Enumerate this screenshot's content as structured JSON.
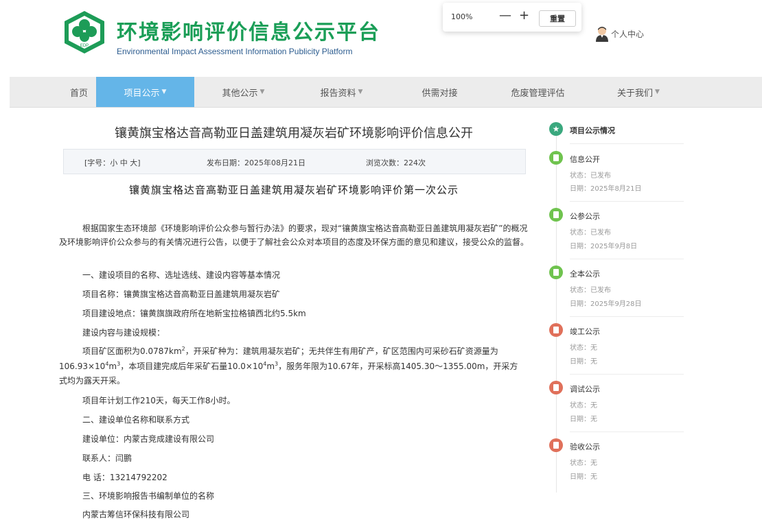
{
  "header": {
    "title": "环境影响评价信息公示平台",
    "subtitle": "Environmental Impact Assessment Information Publicity Platform",
    "logo_text": "EDP"
  },
  "zoom": {
    "level": "100%",
    "minus": "—",
    "plus": "+",
    "reset": "重置"
  },
  "user": {
    "label": "个人中心"
  },
  "nav": {
    "home": "首页",
    "project": "项目公示",
    "other": "其他公示",
    "report": "报告资料",
    "supply": "供需对接",
    "hazard": "危废管理评估",
    "about": "关于我们"
  },
  "article": {
    "title": "镶黄旗宝格达音高勒亚日盖建筑用凝灰岩矿环境影响评价信息公开",
    "font_size": "[字号：小 中 大]",
    "date": "发布日期：2025年08月21日",
    "views": "浏览次数：224次",
    "subtitle": "镶黄旗宝格达音高勒亚日盖建筑用凝灰岩矿环境影响评价第一次公示",
    "intro": "根据国家生态环境部《环境影响评价公众参与暂行办法》的要求，现对“镶黄旗宝格达音高勒亚日盖建筑用凝灰岩矿”的概况及环境影响评价公众参与的有关情况进行公告，以便于了解社会公众对本项目的态度及环保方面的意见和建议，接受公众的监督。",
    "sec1": "一、建设项目的名称、选址选线、建设内容等基本情况",
    "name_line": "项目名称：镶黄旗宝格达音高勒亚日盖建筑用凝灰岩矿",
    "location": "项目建设地点：镶黄旗旗政府所在地新宝拉格镇西北约5.5km",
    "scale_label": "建设内容与建设规模：",
    "scale_a": "项目矿区面积为0.0787km",
    "scale_b": "，开采矿种为：建筑用凝灰岩矿；无共伴生有用矿产，矿区范围内可采砂石矿资源量为",
    "scale_c": "106.93×10",
    "scale_d": "m",
    "scale_e": "，本项目建完成后年采矿石量10.0×10",
    "scale_f": "m",
    "scale_g": "，服务年限为10.67年，开采标高1405.30～1355.00m，开采方",
    "scale_h": "式均为露天开采。",
    "sup2": "2",
    "sup4": "4",
    "sup3": "3",
    "work": "项目年计划工作210天，每天工作8小时。",
    "sec2": "二、建设单位名称和联系方式",
    "unit": "建设单位：内蒙古竞成建设有限公司",
    "contact": "联系人：闫鹏",
    "phone": "电  话：13214792202",
    "sec3": "三、环境影响报告书编制单位的名称",
    "prep_unit": "内蒙古筹信环保科技有限公司"
  },
  "sidebar": {
    "heading": "项目公示情况",
    "items": [
      {
        "name": "信息公开",
        "status": "状态：已发布",
        "date": "日期：2025年8月21日",
        "color": "#6fc34e"
      },
      {
        "name": "公参公示",
        "status": "状态：已发布",
        "date": "日期：2025年9月8日",
        "color": "#6fc34e"
      },
      {
        "name": "全本公示",
        "status": "状态：已发布",
        "date": "日期：2025年9月28日",
        "color": "#6fc34e"
      },
      {
        "name": "竣工公示",
        "status": "状态：无",
        "date": "日期：无",
        "color": "#e0705a"
      },
      {
        "name": "调试公示",
        "status": "状态：无",
        "date": "日期：无",
        "color": "#e0705a"
      },
      {
        "name": "验收公示",
        "status": "状态：无",
        "date": "日期：无",
        "color": "#e0705a"
      }
    ]
  },
  "colors": {
    "brand": "#1a9e57",
    "nav_active": "#64b5e8",
    "published": "#6fc34e",
    "none": "#e0705a"
  }
}
